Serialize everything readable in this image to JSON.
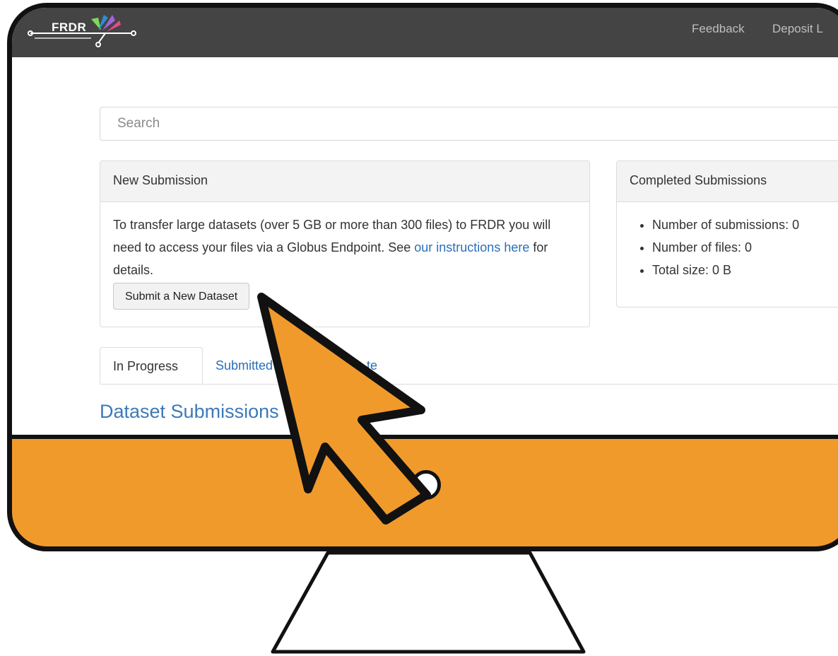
{
  "header": {
    "logo_text": "FRDR",
    "nav": [
      "Feedback",
      "Deposit L"
    ]
  },
  "search": {
    "placeholder": "Search"
  },
  "new_submission": {
    "heading": "New Submission",
    "text_before_link": "To transfer large datasets (over 5 GB or more than 300 files) to FRDR you will need to access your files via a Globus Endpoint. See ",
    "link_text": "our instructions here",
    "text_after_link": " for details.",
    "button_label": "Submit a New Dataset"
  },
  "completed_submissions": {
    "heading": "Completed Submissions",
    "stats": [
      "Number of submissions: 0",
      "Number of files: 0",
      "Total size: 0 B"
    ]
  },
  "tabs": [
    "In Progress",
    "Submitted",
    "te"
  ],
  "section_title": "Dataset Submissions",
  "colors": {
    "navbar": "#444444",
    "monitor_accent": "#f19a2c",
    "link": "#2a6fb8",
    "cursor": "#f19a2c"
  },
  "icons": [
    "frdr-logo",
    "arrow-cursor-icon",
    "webcam-icon"
  ]
}
